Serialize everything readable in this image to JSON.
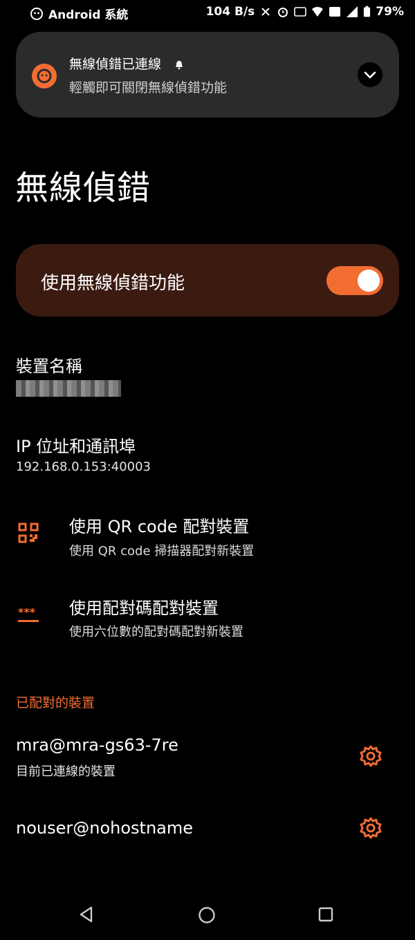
{
  "status_bar": {
    "app_label": "Android 系統",
    "net_speed": "104 B/s",
    "battery": "79%"
  },
  "notification": {
    "title": "無線偵錯已連線",
    "subtitle": "輕觸即可關閉無線偵錯功能"
  },
  "page": {
    "title": "無線偵錯"
  },
  "main_toggle": {
    "label": "使用無線偵錯功能",
    "enabled": true
  },
  "device_name": {
    "label": "裝置名稱"
  },
  "ip": {
    "label": "IP 位址和通訊埠",
    "value": "192.168.0.153:40003"
  },
  "pair_qr": {
    "title": "使用 QR code 配對裝置",
    "subtitle": "使用 QR code 掃描器配對新裝置"
  },
  "pair_code": {
    "title": "使用配對碼配對裝置",
    "subtitle": "使用六位數的配對碼配對新裝置"
  },
  "paired_section": {
    "header": "已配對的裝置",
    "devices": [
      {
        "name": "mra@mra-gs63-7re",
        "status": "目前已連線的裝置"
      },
      {
        "name": "nouser@nohostname",
        "status": ""
      }
    ]
  },
  "colors": {
    "accent": "#f26d32",
    "card_bg": "#3b1a10",
    "notif_bg": "#2b2b2b"
  }
}
